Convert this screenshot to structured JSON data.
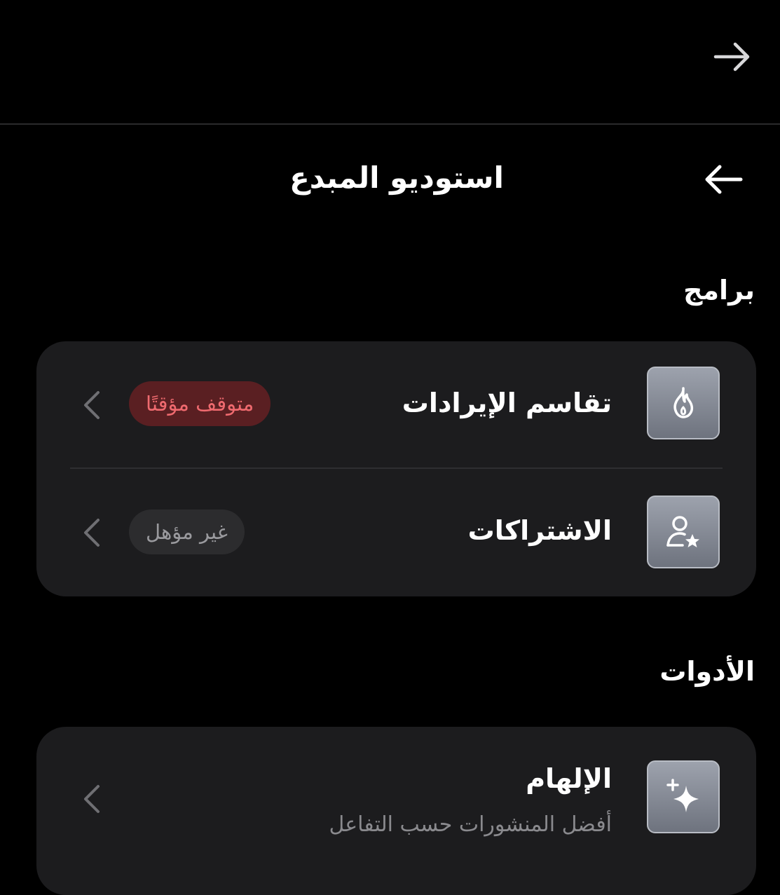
{
  "top_bar": {
    "forward_icon": "arrow-right-icon"
  },
  "header": {
    "title": "استوديو المبدع",
    "back_icon": "arrow-left-icon"
  },
  "sections": [
    {
      "title": "برامج",
      "items": [
        {
          "label": "تقاسم الإيرادات",
          "icon": "flame-icon",
          "badge": "متوقف مؤقتًا",
          "badge_color": "#ef6a6f",
          "badge_bg": "#5a1f22"
        },
        {
          "label": "الاشتراكات",
          "icon": "person-star-icon",
          "badge": "غير مؤهل",
          "badge_color": "#9a9a9e",
          "badge_bg": "#2c2c2e"
        }
      ]
    },
    {
      "title": "الأدوات",
      "items": [
        {
          "label": "الإلهام",
          "sublabel": "أفضل المنشورات حسب التفاعل",
          "icon": "sparkle-icon"
        }
      ]
    }
  ],
  "colors": {
    "background": "#000000",
    "card": "#1c1c1e",
    "tile_gradient_top": "#9da2ad",
    "tile_gradient_bottom": "#6e737e"
  }
}
